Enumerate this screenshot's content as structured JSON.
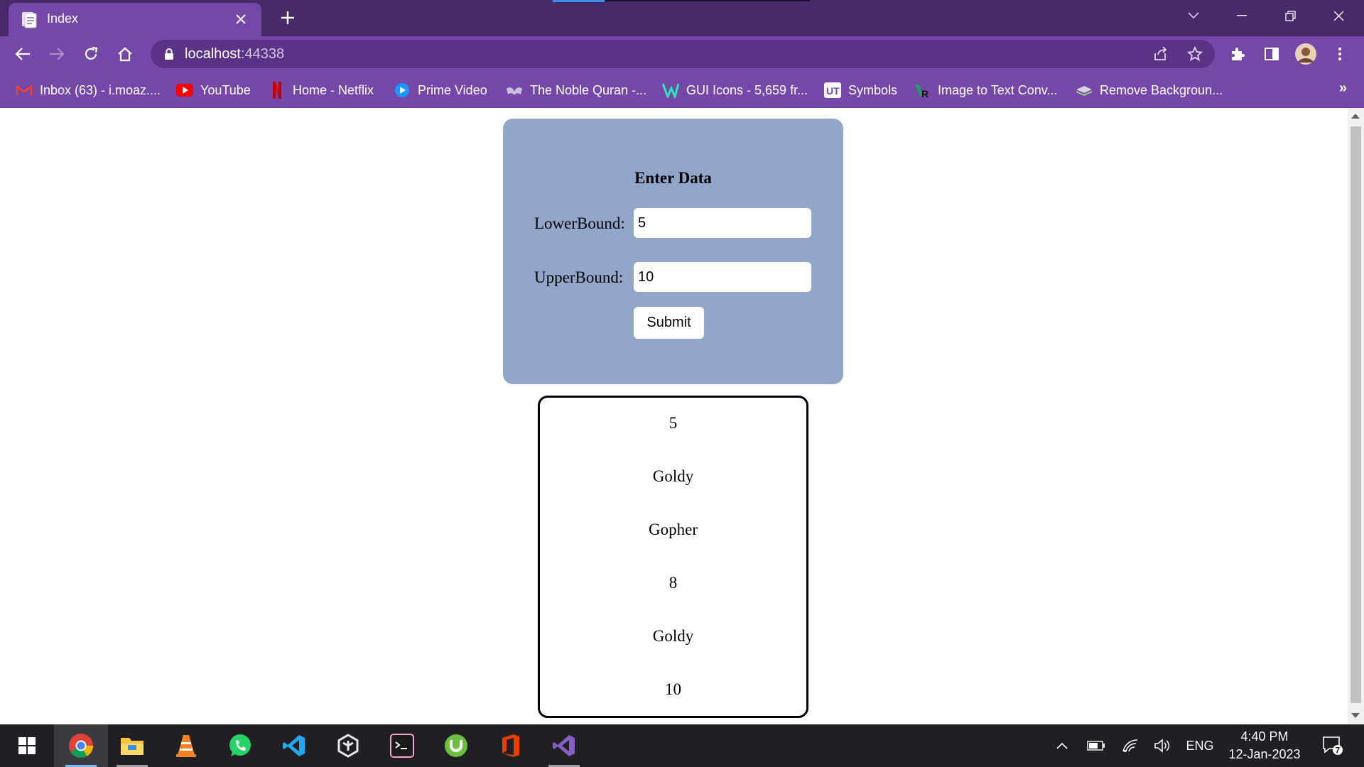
{
  "browser": {
    "tab_title": "Index",
    "url_host": "localhost",
    "url_port": ":44338",
    "bookmarks": [
      {
        "label": "Inbox (63) - i.moaz....",
        "icon": "gmail-icon"
      },
      {
        "label": "YouTube",
        "icon": "youtube-icon"
      },
      {
        "label": "Home - Netflix",
        "icon": "netflix-icon"
      },
      {
        "label": "Prime Video",
        "icon": "prime-video-icon"
      },
      {
        "label": "The Noble Quran -...",
        "icon": "quran-icon"
      },
      {
        "label": "GUI Icons - 5,659 fr...",
        "icon": "gui-icons-icon"
      },
      {
        "label": "Symbols",
        "icon": "ut-icon"
      },
      {
        "label": "Image to Text Conv...",
        "icon": "image-to-text-icon"
      },
      {
        "label": "Remove Backgroun...",
        "icon": "remove-bg-icon"
      }
    ],
    "more_bookmarks": "»",
    "colors": {
      "frame": "#482a6b",
      "toolbar": "#7447a8",
      "omnibox": "#5b3386"
    }
  },
  "form": {
    "title": "Enter Data",
    "lower_label": "LowerBound:",
    "lower_value": "5",
    "upper_label": "UpperBound:",
    "upper_value": "10",
    "submit_label": "Submit",
    "card_color": "#91a6c8"
  },
  "results": [
    "5",
    "Goldy",
    "Gopher",
    "8",
    "Goldy",
    "10"
  ],
  "taskbar": {
    "apps": [
      "windows-start-icon",
      "chrome-icon",
      "file-explorer-icon",
      "vlc-icon",
      "whatsapp-icon",
      "vscode-icon",
      "unity-icon",
      "terminal-icon",
      "utorrent-icon",
      "office-icon",
      "visual-studio-icon"
    ],
    "language": "ENG",
    "time": "4:40 PM",
    "date": "12-Jan-2023",
    "notifications": "7"
  }
}
